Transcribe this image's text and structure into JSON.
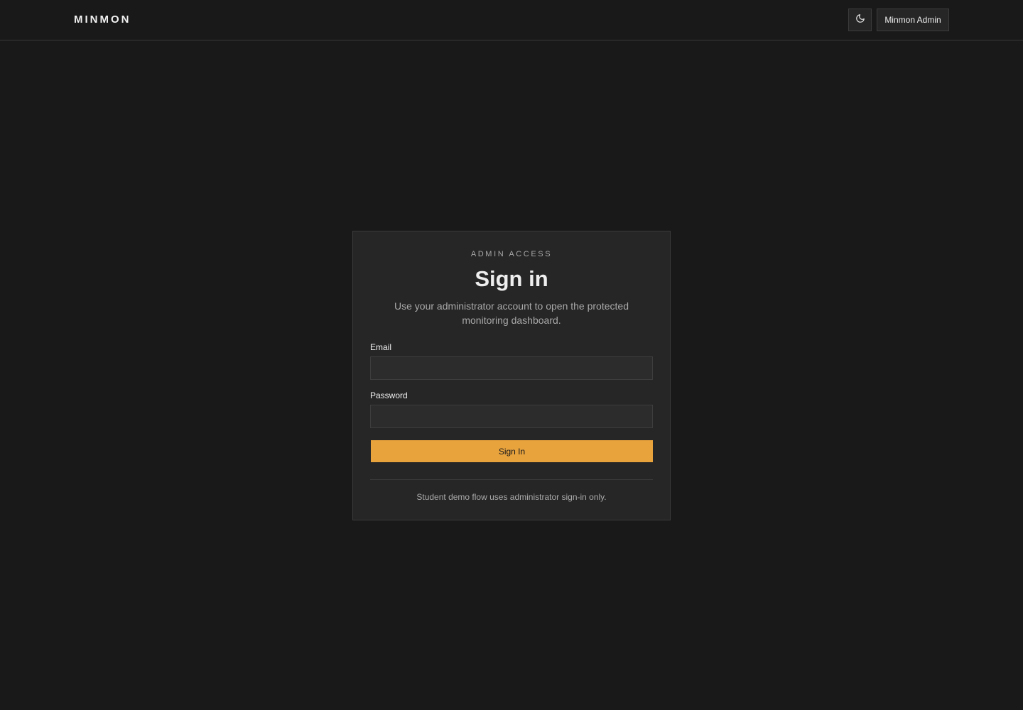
{
  "header": {
    "brand": "MINMON",
    "theme_toggle_icon": "moon-icon",
    "user_button_label": "Minmon Admin"
  },
  "login": {
    "eyebrow": "ADMIN ACCESS",
    "title": "Sign in",
    "subtitle": "Use your administrator account to open the protected monitoring dashboard.",
    "email_label": "Email",
    "email_value": "",
    "password_label": "Password",
    "password_value": "",
    "submit_label": "Sign In",
    "footnote": "Student demo flow uses administrator sign-in only."
  },
  "colors": {
    "background": "#191919",
    "card": "#262626",
    "accent": "#e8a33d"
  }
}
